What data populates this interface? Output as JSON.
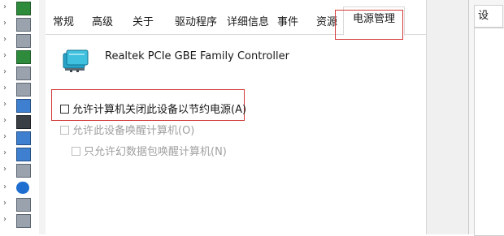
{
  "tabs": [
    {
      "label": "常规",
      "active": false
    },
    {
      "label": "高级",
      "active": false
    },
    {
      "label": "关于",
      "active": false
    },
    {
      "label": "驱动程序",
      "active": false
    },
    {
      "label": "详细信息",
      "active": false
    },
    {
      "label": "事件",
      "active": false
    },
    {
      "label": "资源",
      "active": false
    },
    {
      "label": "电源管理",
      "active": true
    }
  ],
  "device": {
    "name": "Realtek PCIe GBE Family Controller",
    "icon": "network-adapter-icon"
  },
  "options": {
    "allow_turn_off": {
      "label": "允许计算机关闭此设备以节约电源(A)",
      "checked": false,
      "enabled": true
    },
    "allow_wake": {
      "label": "允许此设备唤醒计算机(O)",
      "checked": false,
      "enabled": false
    },
    "only_magic_packet": {
      "label": "只允许幻数据包唤醒计算机(N)",
      "checked": false,
      "enabled": false
    }
  },
  "right_window": {
    "tab_label": "设"
  },
  "colors": {
    "highlight_box": "#d33a3a",
    "disabled_text": "#a0a0a0"
  }
}
